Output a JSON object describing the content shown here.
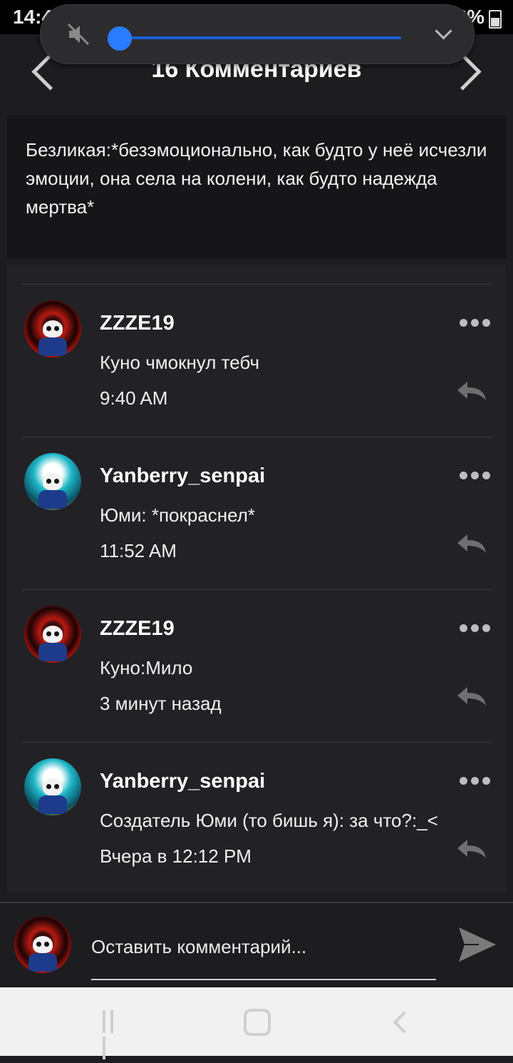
{
  "status_bar": {
    "time": "14:42",
    "battery": "58%"
  },
  "header": {
    "title": "16 Комментариев"
  },
  "post": {
    "text": "Безликая:*безэмоционально, как будто у неё исчезли эмоции, она села на колени, как будто надежда мертва*"
  },
  "comments": [
    {
      "username": "ZZZE19",
      "text": "Куно чмокнул тебч",
      "time": "9:40 AM",
      "avatar": "red"
    },
    {
      "username": "Yanberry_senpai",
      "text": "Юми: *покраснел*",
      "time": "11:52 AM",
      "avatar": "teal"
    },
    {
      "username": "ZZZE19",
      "text": "Куно:Мило",
      "time": "3 минут назад",
      "avatar": "red"
    },
    {
      "username": "Yanberry_senpai",
      "text": "Создатель Юми (то бишь я): за что?:_<",
      "time": "Вчера в 12:12 PM",
      "avatar": "teal"
    }
  ],
  "composer": {
    "placeholder": "Оставить комментарий..."
  },
  "colors": {
    "accent": "#2a7bff",
    "background": "#1d1c1f",
    "panel": "#222125"
  },
  "icons": [
    "mute-icon",
    "chevron-left-icon",
    "chevron-right-icon",
    "more-icon",
    "reply-icon",
    "send-icon"
  ]
}
